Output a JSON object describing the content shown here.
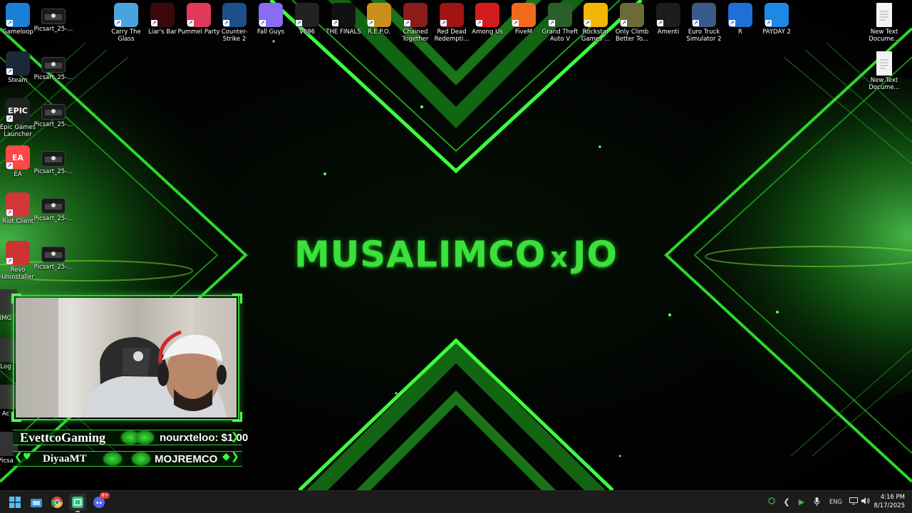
{
  "wallpaper": {
    "title_left": "MUSALIMCO",
    "title_x": "x",
    "title_right": "JO"
  },
  "desktop": {
    "left_column": [
      {
        "label": "Gameloop",
        "icon": "gameloop-icon",
        "color": "#1a7fd6"
      },
      {
        "label": "Steam",
        "icon": "steam-icon",
        "color": "#1b2838"
      },
      {
        "label": "Epic Games Launcher",
        "icon": "epic-games-icon",
        "color": "#222222",
        "glyph": "EPIC"
      },
      {
        "label": "EA",
        "icon": "ea-icon",
        "color": "#ff4747",
        "glyph": "EA"
      },
      {
        "label": "Riot Client",
        "icon": "riot-icon",
        "color": "#d13639"
      },
      {
        "label": "Revo Uninstaller",
        "icon": "revo-uninstaller-icon",
        "color": "#c33"
      },
      {
        "label": "IMG",
        "icon": "image-file-icon",
        "color": "#333333"
      },
      {
        "label": "Log",
        "icon": "log-file-icon",
        "color": "#333333"
      },
      {
        "label": "Ac",
        "icon": "app-file-icon",
        "color": "#333333"
      },
      {
        "label": "Picsa",
        "icon": "picsart-file-icon",
        "color": "#333333"
      }
    ],
    "picsart_column": [
      {
        "label": "Picsart_25-..."
      },
      {
        "label": "Picsart_25-..."
      },
      {
        "label": "Picsart_25-..."
      },
      {
        "label": "Picsart_25-..."
      },
      {
        "label": "Picsart_25-..."
      },
      {
        "label": "Picsart_25-..."
      }
    ],
    "top_row": [
      {
        "label": "Carry The Glass",
        "icon": "carry-the-glass-icon",
        "color": "#4aa3df"
      },
      {
        "label": "Liar's Bar",
        "icon": "liars-bar-icon",
        "color": "#3a0a0a"
      },
      {
        "label": "Pummel Party",
        "icon": "pummel-party-icon",
        "color": "#e0395a"
      },
      {
        "label": "Counter-Strike 2",
        "icon": "counter-strike-icon",
        "color": "#1f4f8a"
      },
      {
        "label": "Fall Guys",
        "icon": "fall-guys-icon",
        "color": "#8a6cf0"
      },
      {
        "label": "V696",
        "icon": "v696-icon",
        "color": "#222222"
      },
      {
        "label": "THE FINALS",
        "icon": "the-finals-icon",
        "color": "#111111"
      },
      {
        "label": "R.E.P.O.",
        "icon": "repo-icon",
        "color": "#c9901c"
      },
      {
        "label": "Chained Together",
        "icon": "chained-together-icon",
        "color": "#8a1c1c"
      },
      {
        "label": "Red Dead Redempti...",
        "icon": "red-dead-icon",
        "color": "#a11414"
      },
      {
        "label": "Among Us",
        "icon": "among-us-icon",
        "color": "#d31b1b"
      },
      {
        "label": "FiveM",
        "icon": "fivem-icon",
        "color": "#f06a1c"
      },
      {
        "label": "Grand Theft Auto V",
        "icon": "gta-v-icon",
        "color": "#2c5e2c"
      },
      {
        "label": "Rockstar Games ...",
        "icon": "rockstar-icon",
        "color": "#f2b705"
      },
      {
        "label": "Only Climb Better To...",
        "icon": "only-climb-icon",
        "color": "#6d6a3a"
      },
      {
        "label": "Amenti",
        "icon": "amenti-icon",
        "color": "#1c1c1c"
      },
      {
        "label": "Euro Truck Simulator 2",
        "icon": "euro-truck-icon",
        "color": "#3a5a8a"
      },
      {
        "label": "R",
        "icon": "rocket-league-icon",
        "color": "#1f6fd6"
      },
      {
        "label": "PAYDAY 2",
        "icon": "payday-icon",
        "color": "#1e88e5"
      }
    ],
    "right_column": [
      {
        "label": "New Text Docume...",
        "icon": "text-document-icon"
      },
      {
        "label": "New Text Docume...",
        "icon": "text-document-icon"
      }
    ]
  },
  "stream_overlay": {
    "top_left": "EvettcoGaming",
    "top_right": "nourxteloo: $1.00",
    "bottom_left": "DiyaaMT",
    "bottom_right": "MOJREMCO"
  },
  "taskbar": {
    "apps": [
      "start-icon",
      "file-explorer-icon",
      "chrome-icon",
      "streaming-app-icon",
      "discord-icon"
    ],
    "discord_badge": "9+",
    "language": "ENG",
    "time": "4:16 PM",
    "date": "8/17/2025"
  }
}
